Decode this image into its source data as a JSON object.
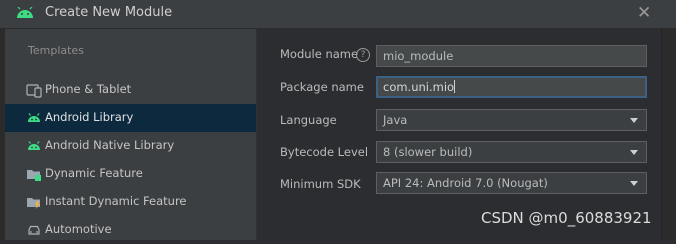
{
  "window": {
    "title": "Create New Module",
    "close_glyph": "✕"
  },
  "sidebar": {
    "section_label": "Templates",
    "items": [
      {
        "label": "Phone & Tablet",
        "icon": "phone-tablet-icon"
      },
      {
        "label": "Android Library",
        "icon": "android-icon",
        "selected": true
      },
      {
        "label": "Android Native Library",
        "icon": "android-native-icon"
      },
      {
        "label": "Dynamic Feature",
        "icon": "dynamic-feature-icon"
      },
      {
        "label": "Instant Dynamic Feature",
        "icon": "instant-dynamic-feature-icon"
      },
      {
        "label": "Automotive",
        "icon": "car-icon"
      }
    ]
  },
  "form": {
    "module_name": {
      "label": "Module name",
      "value": "mio_module",
      "help_glyph": "?"
    },
    "package_name": {
      "label": "Package name",
      "value": "com.uni.mio"
    },
    "language": {
      "label": "Language",
      "value": "Java"
    },
    "bytecode_level": {
      "label": "Bytecode Level",
      "value": "8 (slower build)"
    },
    "minimum_sdk": {
      "label": "Minimum SDK",
      "value": "API 24: Android 7.0 (Nougat)"
    }
  },
  "watermark": "CSDN @m0_60883921",
  "colors": {
    "android_green": "#3ddc84",
    "selection": "#0d293e",
    "focus_border": "#3d6185"
  }
}
